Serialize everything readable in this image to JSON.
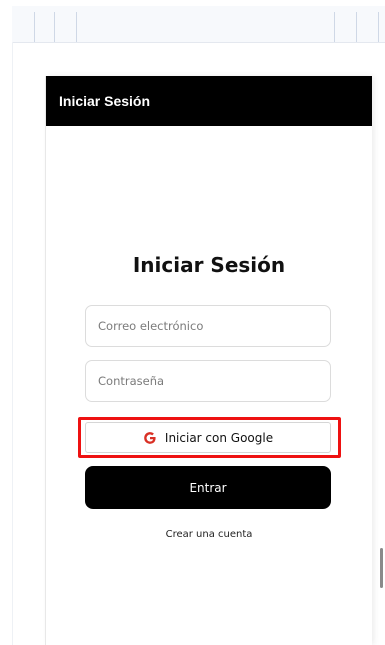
{
  "app_bar": {
    "title": "Iniciar Sesión",
    "background": "#000000"
  },
  "login": {
    "heading": "Iniciar Sesión",
    "email": {
      "placeholder": "Correo electrónico",
      "value": ""
    },
    "password": {
      "placeholder": "Contraseña",
      "value": ""
    },
    "google_button": {
      "icon": "google-g-icon",
      "label": "Iniciar con Google",
      "highlighted": true,
      "highlight_color": "#ee1111"
    },
    "submit_button": {
      "label": "Entrar",
      "background": "#000000"
    },
    "create_account_link": "Crear una cuenta"
  }
}
